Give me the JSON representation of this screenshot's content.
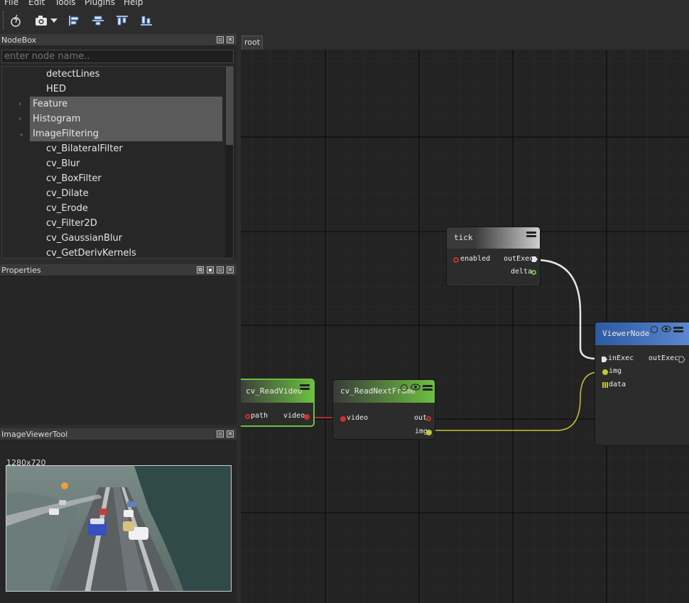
{
  "menu": [
    "File",
    "Edit",
    "Tools",
    "Plugins",
    "Help"
  ],
  "toolbar": {
    "buttons": [
      "bolt-icon",
      "camera-icon",
      "dropdown-arrow-icon",
      "align-left-icon",
      "align-center-icon",
      "align-bottom-icon",
      "align-right-icon"
    ]
  },
  "nodebox": {
    "title": "NodeBox",
    "search_placeholder": "enter node name..",
    "items": [
      {
        "label": "detectLines",
        "kind": "leaf"
      },
      {
        "label": "HED",
        "kind": "leaf"
      },
      {
        "label": "Feature",
        "kind": "category",
        "expanded": false
      },
      {
        "label": "Histogram",
        "kind": "category",
        "expanded": false
      },
      {
        "label": "ImageFiltering",
        "kind": "category",
        "expanded": true
      },
      {
        "label": "cv_BilateralFilter",
        "kind": "leaf"
      },
      {
        "label": "cv_Blur",
        "kind": "leaf"
      },
      {
        "label": "cv_BoxFilter",
        "kind": "leaf"
      },
      {
        "label": "cv_Dilate",
        "kind": "leaf"
      },
      {
        "label": "cv_Erode",
        "kind": "leaf"
      },
      {
        "label": "cv_Filter2D",
        "kind": "leaf"
      },
      {
        "label": "cv_GaussianBlur",
        "kind": "leaf"
      },
      {
        "label": "cv_GetDerivKernels",
        "kind": "leaf"
      }
    ]
  },
  "properties": {
    "title": "Properties"
  },
  "image_viewer": {
    "title": "ImageViewerTool",
    "resolution": "1280x720"
  },
  "graph": {
    "tab": "root",
    "nodes": {
      "tick": {
        "title": "tick",
        "in": [
          "enabled"
        ],
        "out": [
          "outExec",
          "delta"
        ]
      },
      "viewer": {
        "title": "ViewerNode",
        "in": [
          "inExec",
          "img",
          "data"
        ],
        "out": [
          "outExec"
        ]
      },
      "read_video": {
        "title": "cv_ReadVideo",
        "in": [
          "path"
        ],
        "out": [
          "video"
        ]
      },
      "read_next_frame": {
        "title": "cv_ReadNextFrame",
        "in": [
          "video"
        ],
        "out": [
          "out",
          "img"
        ]
      }
    }
  },
  "colors": {
    "exec_wire": "#e6e6e6",
    "video_wire": "#a83232",
    "img_wire": "#c8c832",
    "viewer_header": "#2c5aa0",
    "read_video_header": "#5ca632"
  }
}
